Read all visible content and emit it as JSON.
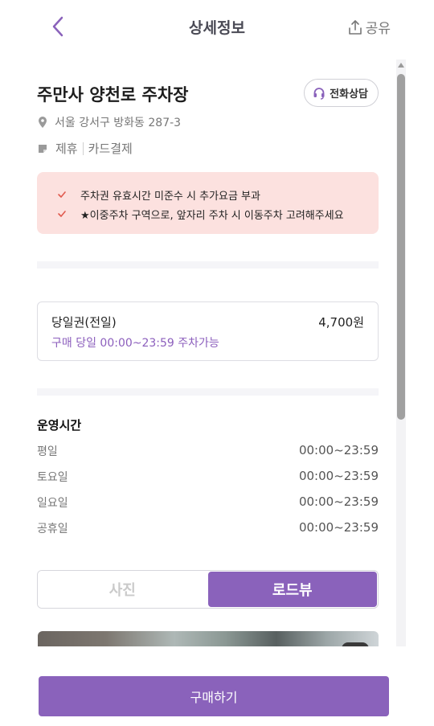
{
  "header": {
    "title": "상세정보",
    "share_label": "공유"
  },
  "lot": {
    "name": "주만사 양천로 주차장",
    "call_label": "전화상담",
    "address": "서울 강서구 방화동 287-3",
    "tags": [
      "제휴",
      "카드결제"
    ]
  },
  "notices": [
    "주차권 유효시간 미준수 시 추가요금 부과",
    "★이중주차 구역으로, 앞자리 주차 시 이동주차 고려해주세요"
  ],
  "ticket": {
    "name": "당일권(전일)",
    "price": "4,700원",
    "description": "구매 당일 00:00~23:59 주차가능"
  },
  "hours": {
    "title": "운영시간",
    "rows": [
      {
        "day": "평일",
        "time": "00:00~23:59"
      },
      {
        "day": "토요일",
        "time": "00:00~23:59"
      },
      {
        "day": "일요일",
        "time": "00:00~23:59"
      },
      {
        "day": "공휴일",
        "time": "00:00~23:59"
      }
    ]
  },
  "tabs": {
    "photo_label": "사진",
    "roadview_label": "로드뷰",
    "active": "roadview"
  },
  "footer": {
    "buy_label": "구매하기"
  },
  "colors": {
    "accent": "#8a62bb",
    "notice_bg": "#fce1df",
    "check": "#e05a4e"
  },
  "icons": {
    "back": "chevron-left-icon",
    "share": "share-upload-icon",
    "call": "headset-icon",
    "location": "location-pin-icon",
    "tag": "tag-icon",
    "check": "check-icon"
  }
}
